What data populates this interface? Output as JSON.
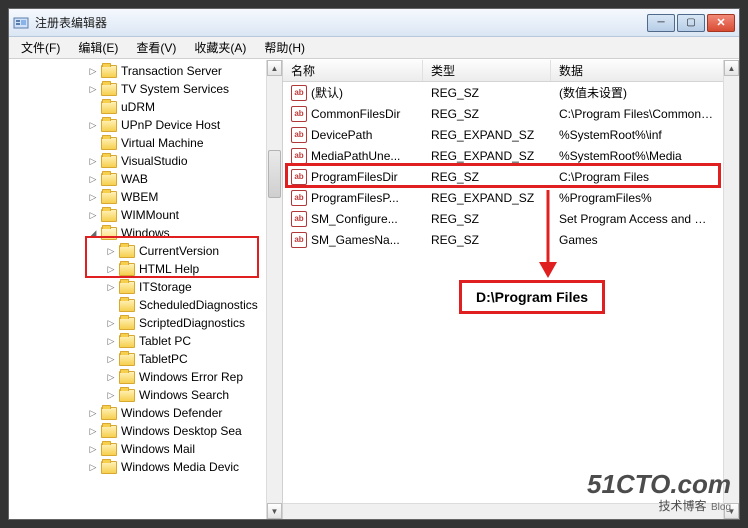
{
  "window": {
    "title": "注册表编辑器"
  },
  "menu": {
    "file": "文件(F)",
    "edit": "编辑(E)",
    "view": "查看(V)",
    "favorites": "收藏夹(A)",
    "help": "帮助(H)"
  },
  "tree": [
    {
      "indent": 78,
      "exp": "▷",
      "label": "Transaction Server"
    },
    {
      "indent": 78,
      "exp": "▷",
      "label": "TV System Services"
    },
    {
      "indent": 78,
      "exp": "",
      "label": "uDRM"
    },
    {
      "indent": 78,
      "exp": "▷",
      "label": "UPnP Device Host"
    },
    {
      "indent": 78,
      "exp": "",
      "label": "Virtual Machine"
    },
    {
      "indent": 78,
      "exp": "▷",
      "label": "VisualStudio"
    },
    {
      "indent": 78,
      "exp": "▷",
      "label": "WAB"
    },
    {
      "indent": 78,
      "exp": "▷",
      "label": "WBEM"
    },
    {
      "indent": 78,
      "exp": "▷",
      "label": "WIMMount"
    },
    {
      "indent": 78,
      "exp": "◢",
      "label": "Windows",
      "open": true
    },
    {
      "indent": 96,
      "exp": "▷",
      "label": "CurrentVersion"
    },
    {
      "indent": 96,
      "exp": "▷",
      "label": "HTML Help"
    },
    {
      "indent": 96,
      "exp": "▷",
      "label": "ITStorage"
    },
    {
      "indent": 96,
      "exp": "",
      "label": "ScheduledDiagnostics"
    },
    {
      "indent": 96,
      "exp": "▷",
      "label": "ScriptedDiagnostics"
    },
    {
      "indent": 96,
      "exp": "▷",
      "label": "Tablet PC"
    },
    {
      "indent": 96,
      "exp": "▷",
      "label": "TabletPC"
    },
    {
      "indent": 96,
      "exp": "▷",
      "label": "Windows Error Rep"
    },
    {
      "indent": 96,
      "exp": "▷",
      "label": "Windows Search"
    },
    {
      "indent": 78,
      "exp": "▷",
      "label": "Windows Defender"
    },
    {
      "indent": 78,
      "exp": "▷",
      "label": "Windows Desktop Sea"
    },
    {
      "indent": 78,
      "exp": "▷",
      "label": "Windows Mail"
    },
    {
      "indent": 78,
      "exp": "▷",
      "label": "Windows Media Devic"
    }
  ],
  "columns": {
    "name": "名称",
    "type": "类型",
    "data": "数据"
  },
  "rows": [
    {
      "name": "(默认)",
      "type": "REG_SZ",
      "data": "(数值未设置)"
    },
    {
      "name": "CommonFilesDir",
      "type": "REG_SZ",
      "data": "C:\\Program Files\\Common Files"
    },
    {
      "name": "DevicePath",
      "type": "REG_EXPAND_SZ",
      "data": "%SystemRoot%\\inf"
    },
    {
      "name": "MediaPathUne...",
      "type": "REG_EXPAND_SZ",
      "data": "%SystemRoot%\\Media"
    },
    {
      "name": "ProgramFilesDir",
      "type": "REG_SZ",
      "data": "C:\\Program Files"
    },
    {
      "name": "ProgramFilesP...",
      "type": "REG_EXPAND_SZ",
      "data": "%ProgramFiles%"
    },
    {
      "name": "SM_Configure...",
      "type": "REG_SZ",
      "data": "Set Program Access and Defaults"
    },
    {
      "name": "SM_GamesNa...",
      "type": "REG_SZ",
      "data": "Games"
    }
  ],
  "icon_text": "ab",
  "annotation": {
    "label": "D:\\Program Files"
  },
  "watermark": {
    "big": "51CTO.com",
    "small": "技术博客",
    "blog": "Blog"
  }
}
